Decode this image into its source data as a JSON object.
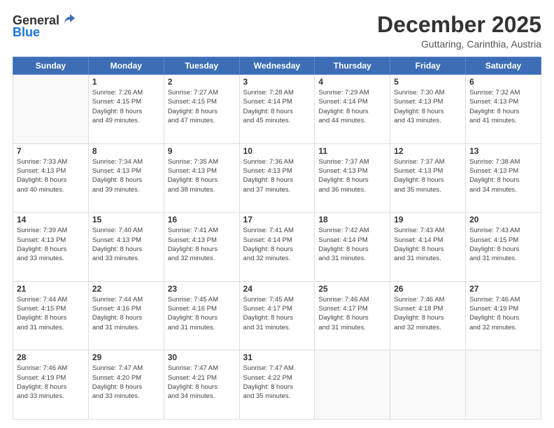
{
  "header": {
    "logo_general": "General",
    "logo_blue": "Blue",
    "month_title": "December 2025",
    "subtitle": "Guttaring, Carinthia, Austria"
  },
  "days_of_week": [
    "Sunday",
    "Monday",
    "Tuesday",
    "Wednesday",
    "Thursday",
    "Friday",
    "Saturday"
  ],
  "weeks": [
    [
      {
        "day": "",
        "info": ""
      },
      {
        "day": "1",
        "info": "Sunrise: 7:26 AM\nSunset: 4:15 PM\nDaylight: 8 hours\nand 49 minutes."
      },
      {
        "day": "2",
        "info": "Sunrise: 7:27 AM\nSunset: 4:15 PM\nDaylight: 8 hours\nand 47 minutes."
      },
      {
        "day": "3",
        "info": "Sunrise: 7:28 AM\nSunset: 4:14 PM\nDaylight: 8 hours\nand 45 minutes."
      },
      {
        "day": "4",
        "info": "Sunrise: 7:29 AM\nSunset: 4:14 PM\nDaylight: 8 hours\nand 44 minutes."
      },
      {
        "day": "5",
        "info": "Sunrise: 7:30 AM\nSunset: 4:13 PM\nDaylight: 8 hours\nand 43 minutes."
      },
      {
        "day": "6",
        "info": "Sunrise: 7:32 AM\nSunset: 4:13 PM\nDaylight: 8 hours\nand 41 minutes."
      }
    ],
    [
      {
        "day": "7",
        "info": "Sunrise: 7:33 AM\nSunset: 4:13 PM\nDaylight: 8 hours\nand 40 minutes."
      },
      {
        "day": "8",
        "info": "Sunrise: 7:34 AM\nSunset: 4:13 PM\nDaylight: 8 hours\nand 39 minutes."
      },
      {
        "day": "9",
        "info": "Sunrise: 7:35 AM\nSunset: 4:13 PM\nDaylight: 8 hours\nand 38 minutes."
      },
      {
        "day": "10",
        "info": "Sunrise: 7:36 AM\nSunset: 4:13 PM\nDaylight: 8 hours\nand 37 minutes."
      },
      {
        "day": "11",
        "info": "Sunrise: 7:37 AM\nSunset: 4:13 PM\nDaylight: 8 hours\nand 36 minutes."
      },
      {
        "day": "12",
        "info": "Sunrise: 7:37 AM\nSunset: 4:13 PM\nDaylight: 8 hours\nand 35 minutes."
      },
      {
        "day": "13",
        "info": "Sunrise: 7:38 AM\nSunset: 4:13 PM\nDaylight: 8 hours\nand 34 minutes."
      }
    ],
    [
      {
        "day": "14",
        "info": "Sunrise: 7:39 AM\nSunset: 4:13 PM\nDaylight: 8 hours\nand 33 minutes."
      },
      {
        "day": "15",
        "info": "Sunrise: 7:40 AM\nSunset: 4:13 PM\nDaylight: 8 hours\nand 33 minutes."
      },
      {
        "day": "16",
        "info": "Sunrise: 7:41 AM\nSunset: 4:13 PM\nDaylight: 8 hours\nand 32 minutes."
      },
      {
        "day": "17",
        "info": "Sunrise: 7:41 AM\nSunset: 4:14 PM\nDaylight: 8 hours\nand 32 minutes."
      },
      {
        "day": "18",
        "info": "Sunrise: 7:42 AM\nSunset: 4:14 PM\nDaylight: 8 hours\nand 31 minutes."
      },
      {
        "day": "19",
        "info": "Sunrise: 7:43 AM\nSunset: 4:14 PM\nDaylight: 8 hours\nand 31 minutes."
      },
      {
        "day": "20",
        "info": "Sunrise: 7:43 AM\nSunset: 4:15 PM\nDaylight: 8 hours\nand 31 minutes."
      }
    ],
    [
      {
        "day": "21",
        "info": "Sunrise: 7:44 AM\nSunset: 4:15 PM\nDaylight: 8 hours\nand 31 minutes."
      },
      {
        "day": "22",
        "info": "Sunrise: 7:44 AM\nSunset: 4:16 PM\nDaylight: 8 hours\nand 31 minutes."
      },
      {
        "day": "23",
        "info": "Sunrise: 7:45 AM\nSunset: 4:16 PM\nDaylight: 8 hours\nand 31 minutes."
      },
      {
        "day": "24",
        "info": "Sunrise: 7:45 AM\nSunset: 4:17 PM\nDaylight: 8 hours\nand 31 minutes."
      },
      {
        "day": "25",
        "info": "Sunrise: 7:46 AM\nSunset: 4:17 PM\nDaylight: 8 hours\nand 31 minutes."
      },
      {
        "day": "26",
        "info": "Sunrise: 7:46 AM\nSunset: 4:18 PM\nDaylight: 8 hours\nand 32 minutes."
      },
      {
        "day": "27",
        "info": "Sunrise: 7:46 AM\nSunset: 4:19 PM\nDaylight: 8 hours\nand 32 minutes."
      }
    ],
    [
      {
        "day": "28",
        "info": "Sunrise: 7:46 AM\nSunset: 4:19 PM\nDaylight: 8 hours\nand 33 minutes."
      },
      {
        "day": "29",
        "info": "Sunrise: 7:47 AM\nSunset: 4:20 PM\nDaylight: 8 hours\nand 33 minutes."
      },
      {
        "day": "30",
        "info": "Sunrise: 7:47 AM\nSunset: 4:21 PM\nDaylight: 8 hours\nand 34 minutes."
      },
      {
        "day": "31",
        "info": "Sunrise: 7:47 AM\nSunset: 4:22 PM\nDaylight: 8 hours\nand 35 minutes."
      },
      {
        "day": "",
        "info": ""
      },
      {
        "day": "",
        "info": ""
      },
      {
        "day": "",
        "info": ""
      }
    ]
  ]
}
